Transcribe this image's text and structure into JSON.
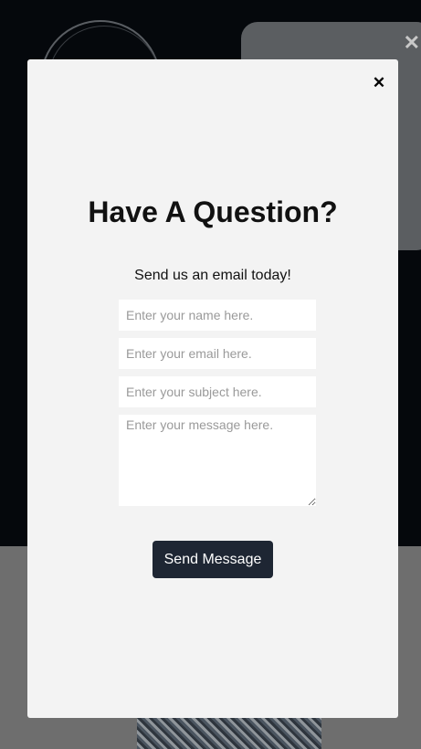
{
  "background": {
    "panel_close_icon": "close-icon"
  },
  "modal": {
    "close_icon": "close-icon",
    "close_glyph": "✕",
    "title": "Have A Question?",
    "subtitle": "Send us an email today!",
    "fields": {
      "name_placeholder": "Enter your name here.",
      "email_placeholder": "Enter your email here.",
      "subject_placeholder": "Enter your subject here.",
      "message_placeholder": "Enter your message here."
    },
    "send_label": "Send Message"
  },
  "colors": {
    "modal_bg": "#f3f3f3",
    "button_bg": "#1e2633",
    "button_text": "#ffffff",
    "page_dark": "#05080c"
  }
}
